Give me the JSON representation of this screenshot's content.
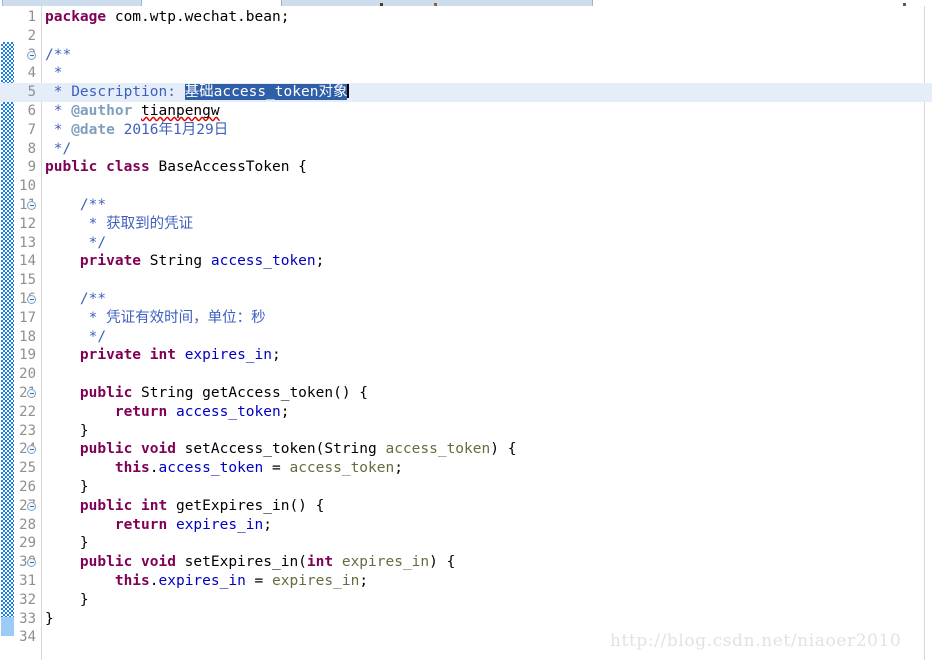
{
  "window": {
    "app": "eclipse-java-editor",
    "tabs": [
      {
        "name": "editor-tab-left",
        "label": ""
      },
      {
        "name": "editor-tab-active",
        "label": ""
      }
    ]
  },
  "watermark": {
    "text": "http://blog.csdn.net/niaoer2010"
  },
  "editor": {
    "language": "Java",
    "gutter_sep_color": "#d8d8d8",
    "highlight_color": "#e4edf8",
    "selection_bg": "#2f5fa8",
    "selection_fg": "#ffffff",
    "change_bar_color": "#1a7fe0",
    "colors": {
      "keyword": "#7f0055",
      "comment": "#3f5fbf",
      "javadoc_tag": "#7f9fbf",
      "field": "#0000c0",
      "parameter": "#6a6a3f",
      "plain": "#000000",
      "line_number": "#8f8f8f",
      "watermark": "#e2e2e2"
    },
    "lines": [
      {
        "n": "1",
        "fold": false,
        "highlight": false,
        "tokens": [
          {
            "t": "package",
            "c": "kw"
          },
          {
            "t": " com.wtp.wechat.bean;",
            "c": "plain"
          }
        ]
      },
      {
        "n": "2",
        "fold": false,
        "highlight": false,
        "tokens": []
      },
      {
        "n": "3",
        "fold": true,
        "highlight": false,
        "tokens": [
          {
            "t": "/**",
            "c": "jdoc"
          }
        ]
      },
      {
        "n": "4",
        "fold": false,
        "highlight": false,
        "tokens": [
          {
            "t": " *",
            "c": "jdoc"
          }
        ]
      },
      {
        "n": "5",
        "fold": false,
        "highlight": true,
        "tokens": [
          {
            "t": " * Description: ",
            "c": "jdoc"
          },
          {
            "t": "基础access_token对象",
            "c": "sel"
          },
          {
            "t": "",
            "c": "caret"
          }
        ]
      },
      {
        "n": "6",
        "fold": false,
        "highlight": false,
        "tokens": [
          {
            "t": " * ",
            "c": "jdoc"
          },
          {
            "t": "@author",
            "c": "jtag"
          },
          {
            "t": " ",
            "c": "jdoc"
          },
          {
            "t": "tianpengw",
            "c": "spell"
          }
        ]
      },
      {
        "n": "7",
        "fold": false,
        "highlight": false,
        "tokens": [
          {
            "t": " * ",
            "c": "jdoc"
          },
          {
            "t": "@date",
            "c": "jtag"
          },
          {
            "t": " 2016年1月29日",
            "c": "jdoc"
          }
        ]
      },
      {
        "n": "8",
        "fold": false,
        "highlight": false,
        "tokens": [
          {
            "t": " */",
            "c": "jdoc"
          }
        ]
      },
      {
        "n": "9",
        "fold": false,
        "highlight": false,
        "tokens": [
          {
            "t": "public class",
            "c": "kw"
          },
          {
            "t": " BaseAccessToken {",
            "c": "plain"
          }
        ]
      },
      {
        "n": "10",
        "fold": false,
        "highlight": false,
        "tokens": []
      },
      {
        "n": "11",
        "fold": true,
        "highlight": false,
        "tokens": [
          {
            "t": "    /**",
            "c": "jdoc"
          }
        ]
      },
      {
        "n": "12",
        "fold": false,
        "highlight": false,
        "tokens": [
          {
            "t": "     * 获取到的凭证",
            "c": "jdoc"
          }
        ]
      },
      {
        "n": "13",
        "fold": false,
        "highlight": false,
        "tokens": [
          {
            "t": "     */",
            "c": "jdoc"
          }
        ]
      },
      {
        "n": "14",
        "fold": false,
        "highlight": false,
        "tokens": [
          {
            "t": "    ",
            "c": "plain"
          },
          {
            "t": "private",
            "c": "kw"
          },
          {
            "t": " String ",
            "c": "plain"
          },
          {
            "t": "access_token",
            "c": "field"
          },
          {
            "t": ";",
            "c": "plain"
          }
        ]
      },
      {
        "n": "15",
        "fold": false,
        "highlight": false,
        "tokens": []
      },
      {
        "n": "16",
        "fold": true,
        "highlight": false,
        "tokens": [
          {
            "t": "    /**",
            "c": "jdoc"
          }
        ]
      },
      {
        "n": "17",
        "fold": false,
        "highlight": false,
        "tokens": [
          {
            "t": "     * 凭证有效时间，单位：秒",
            "c": "jdoc"
          }
        ]
      },
      {
        "n": "18",
        "fold": false,
        "highlight": false,
        "tokens": [
          {
            "t": "     */",
            "c": "jdoc"
          }
        ]
      },
      {
        "n": "19",
        "fold": false,
        "highlight": false,
        "tokens": [
          {
            "t": "    ",
            "c": "plain"
          },
          {
            "t": "private int",
            "c": "kw"
          },
          {
            "t": " ",
            "c": "plain"
          },
          {
            "t": "expires_in",
            "c": "field"
          },
          {
            "t": ";",
            "c": "plain"
          }
        ]
      },
      {
        "n": "20",
        "fold": false,
        "highlight": false,
        "tokens": []
      },
      {
        "n": "21",
        "fold": true,
        "highlight": false,
        "tokens": [
          {
            "t": "    ",
            "c": "plain"
          },
          {
            "t": "public",
            "c": "kw"
          },
          {
            "t": " String getAccess_token() {",
            "c": "plain"
          }
        ]
      },
      {
        "n": "22",
        "fold": false,
        "highlight": false,
        "tokens": [
          {
            "t": "        ",
            "c": "plain"
          },
          {
            "t": "return",
            "c": "kw"
          },
          {
            "t": " ",
            "c": "plain"
          },
          {
            "t": "access_token",
            "c": "field"
          },
          {
            "t": ";",
            "c": "plain"
          }
        ]
      },
      {
        "n": "23",
        "fold": false,
        "highlight": false,
        "tokens": [
          {
            "t": "    }",
            "c": "plain"
          }
        ]
      },
      {
        "n": "24",
        "fold": true,
        "highlight": false,
        "tokens": [
          {
            "t": "    ",
            "c": "plain"
          },
          {
            "t": "public void",
            "c": "kw"
          },
          {
            "t": " setAccess_token(String ",
            "c": "plain"
          },
          {
            "t": "access_token",
            "c": "param"
          },
          {
            "t": ") {",
            "c": "plain"
          }
        ]
      },
      {
        "n": "25",
        "fold": false,
        "highlight": false,
        "tokens": [
          {
            "t": "        ",
            "c": "plain"
          },
          {
            "t": "this",
            "c": "kw"
          },
          {
            "t": ".",
            "c": "plain"
          },
          {
            "t": "access_token",
            "c": "field"
          },
          {
            "t": " = ",
            "c": "plain"
          },
          {
            "t": "access_token",
            "c": "param"
          },
          {
            "t": ";",
            "c": "plain"
          }
        ]
      },
      {
        "n": "26",
        "fold": false,
        "highlight": false,
        "tokens": [
          {
            "t": "    }",
            "c": "plain"
          }
        ]
      },
      {
        "n": "27",
        "fold": true,
        "highlight": false,
        "tokens": [
          {
            "t": "    ",
            "c": "plain"
          },
          {
            "t": "public int",
            "c": "kw"
          },
          {
            "t": " getExpires_in() {",
            "c": "plain"
          }
        ]
      },
      {
        "n": "28",
        "fold": false,
        "highlight": false,
        "tokens": [
          {
            "t": "        ",
            "c": "plain"
          },
          {
            "t": "return",
            "c": "kw"
          },
          {
            "t": " ",
            "c": "plain"
          },
          {
            "t": "expires_in",
            "c": "field"
          },
          {
            "t": ";",
            "c": "plain"
          }
        ]
      },
      {
        "n": "29",
        "fold": false,
        "highlight": false,
        "tokens": [
          {
            "t": "    }",
            "c": "plain"
          }
        ]
      },
      {
        "n": "30",
        "fold": true,
        "highlight": false,
        "tokens": [
          {
            "t": "    ",
            "c": "plain"
          },
          {
            "t": "public void",
            "c": "kw"
          },
          {
            "t": " setExpires_in(",
            "c": "plain"
          },
          {
            "t": "int",
            "c": "kw"
          },
          {
            "t": " ",
            "c": "plain"
          },
          {
            "t": "expires_in",
            "c": "param"
          },
          {
            "t": ") {",
            "c": "plain"
          }
        ]
      },
      {
        "n": "31",
        "fold": false,
        "highlight": false,
        "tokens": [
          {
            "t": "        ",
            "c": "plain"
          },
          {
            "t": "this",
            "c": "kw"
          },
          {
            "t": ".",
            "c": "plain"
          },
          {
            "t": "expires_in",
            "c": "field"
          },
          {
            "t": " = ",
            "c": "plain"
          },
          {
            "t": "expires_in",
            "c": "param"
          },
          {
            "t": ";",
            "c": "plain"
          }
        ]
      },
      {
        "n": "32",
        "fold": false,
        "highlight": false,
        "tokens": [
          {
            "t": "    }",
            "c": "plain"
          }
        ]
      },
      {
        "n": "33",
        "fold": false,
        "highlight": false,
        "tokens": [
          {
            "t": "}",
            "c": "plain"
          }
        ]
      },
      {
        "n": "34",
        "fold": false,
        "highlight": false,
        "tokens": []
      }
    ]
  }
}
